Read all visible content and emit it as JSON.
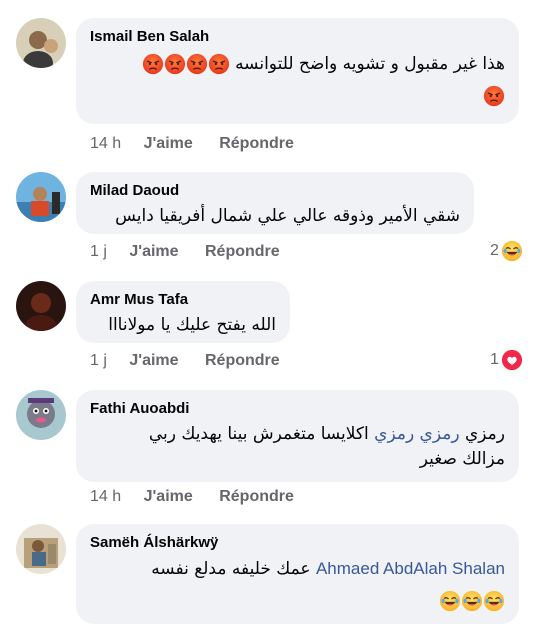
{
  "comments": [
    {
      "author": "Ismail Ben Salah",
      "text": "هذا غير مقبول و تشويه واضح للتوانسه",
      "time": "14 h",
      "like": "J'aime",
      "reply": "Répondre",
      "emojis": [
        "angry-emoji",
        "angry-emoji",
        "angry-emoji",
        "angry-emoji",
        "angry-emoji"
      ]
    },
    {
      "author": "Milad Daoud",
      "text": "شقي الأمير وذوقه عالي علي شمال أفريقيا دايس",
      "time": "1 j",
      "like": "J'aime",
      "reply": "Répondre",
      "reaction_count": "2",
      "reaction": "laughing-emoji"
    },
    {
      "author": "Amr Mus Tafa",
      "text": "الله يفتح عليك يا مولانااا",
      "time": "1 j",
      "like": "J'aime",
      "reply": "Répondre",
      "reaction_count": "1",
      "reaction": "love-reaction"
    },
    {
      "author": "Fathi Auoabdi",
      "text_tag": "رمزي رمزي",
      "text_pre": "رمزي",
      "text_post": "اكلايسا متغمرش بينا يهديك ربي",
      "text_line2": "مزالك صغير",
      "time": "14 h",
      "like": "J'aime",
      "reply": "Répondre"
    },
    {
      "author": "Samëh Álshärkwÿ",
      "text_tag": "Ahmaed AbdAlah Shalan",
      "text_rest": "عمك خليفه مدلع نفسه",
      "emojis": [
        "laughing-emoji",
        "laughing-emoji",
        "laughing-emoji"
      ]
    }
  ],
  "colors": {
    "bubble": "#f0f2f5",
    "meta": "#65676b",
    "tag": "#385898",
    "love": "#f02849"
  }
}
